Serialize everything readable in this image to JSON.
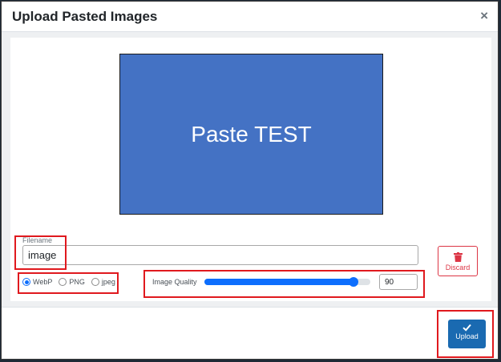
{
  "dialog": {
    "title": "Upload Pasted Images",
    "close_label": "×"
  },
  "preview": {
    "text": "Paste TEST",
    "background_color": "#4472c4"
  },
  "filename": {
    "label": "Filename",
    "value": "image"
  },
  "format": {
    "options": [
      {
        "label": "WebP",
        "checked": true
      },
      {
        "label": "PNG",
        "checked": false
      },
      {
        "label": "jpeg",
        "checked": false
      }
    ]
  },
  "quality": {
    "label": "Image Quality",
    "value": "90",
    "min": 0,
    "max": 100,
    "slider_value": 90
  },
  "actions": {
    "discard_label": "Discard",
    "discard_icon": "trash-icon",
    "upload_label": "Upload",
    "upload_icon": "check-icon"
  },
  "colors": {
    "primary": "#0d6efd",
    "upload_button": "#1a6ab1",
    "danger": "#dc3545",
    "highlight_box": "#e0191e"
  }
}
